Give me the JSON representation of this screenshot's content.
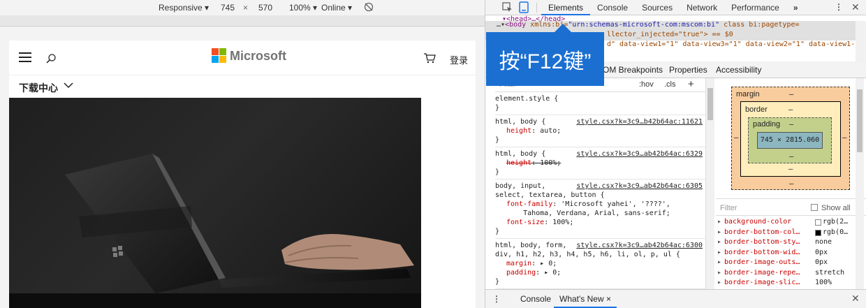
{
  "devbar": {
    "mode": "Responsive",
    "width": "745",
    "times": "×",
    "height": "570",
    "zoom": "100%",
    "network": "Online"
  },
  "site": {
    "brand": "Microsoft",
    "cart_label": "登录",
    "download_center": "下载中心"
  },
  "devtools": {
    "tabs": [
      "Elements",
      "Console",
      "Sources",
      "Network",
      "Performance"
    ],
    "more": "»",
    "dom": {
      "line0": "▾<head>…</head>",
      "line1_prefix": "…▾",
      "line1_tag": "<body",
      "line1_attr": " xmlns:bi=",
      "line1_val": "\"urn:schemas-microsoft-com:mscom:bi\"",
      "line1_rest": " class bi:pagetype=",
      "line2": "llector_injected=\"true\"> == $0",
      "line3": "d\" data-view1=\"1\" data-view3=\"1\" data-view2=\"1\" data-view1-"
    },
    "subtabs": [
      "OM Breakpoints",
      "Properties",
      "Accessibility"
    ],
    "filter_placeholder": "Filter",
    "hov": ":hov",
    "cls": ".cls",
    "plus": "+",
    "styles": [
      {
        "sel": "element.style {",
        "lines": [],
        "close": "}",
        "src": ""
      },
      {
        "sel": "html, body {",
        "lines": [
          {
            "p": "height",
            "v": "auto;"
          }
        ],
        "close": "}",
        "src": "style.csx?k=3c9…b42b64ac:11621",
        "strike": false
      },
      {
        "sel": "html, body {",
        "lines": [
          {
            "p": "height",
            "v": "100%;"
          }
        ],
        "close": "}",
        "src": "style.csx?k=3c9…ab42b64ac:6329",
        "strike": true
      },
      {
        "sel": "body, input,\nselect, textarea, button {",
        "lines": [
          {
            "p": "font-family",
            "v": "'Microsoft yahei', '????',\n    Tahoma, Verdana, Arial, sans-serif;"
          },
          {
            "p": "font-size",
            "v": "100%;"
          }
        ],
        "close": "}",
        "src": "style.csx?k=3c9…ab42b64ac:6305",
        "strike": false
      },
      {
        "sel": "html, body, form,\ndiv, h1, h2, h3, h4, h5, h6, li, ol, p, ul {",
        "lines": [
          {
            "p": "margin",
            "v": "▸ 0;"
          },
          {
            "p": "padding",
            "v": "▸ 0;"
          }
        ],
        "close": "}",
        "src": "style.csx?k=3c9…ab42b64ac:6300",
        "strike": false
      }
    ],
    "boxmodel": {
      "margin": "margin",
      "border": "border",
      "padding": "padding",
      "dash": "–",
      "content": "745 × 2815.060"
    },
    "computed_filter": "Filter",
    "show_all": "Show all",
    "computed": [
      {
        "p": "background-color",
        "v": "rgb(2…",
        "sw": "#ffffff"
      },
      {
        "p": "border-bottom-col…",
        "v": "rgb(0…",
        "sw": "#000000"
      },
      {
        "p": "border-bottom-sty…",
        "v": "none",
        "sw": ""
      },
      {
        "p": "border-bottom-wid…",
        "v": "0px",
        "sw": ""
      },
      {
        "p": "border-image-outs…",
        "v": "0px",
        "sw": ""
      },
      {
        "p": "border-image-repe…",
        "v": "stretch",
        "sw": ""
      },
      {
        "p": "border-image-slic…",
        "v": "100%",
        "sw": ""
      }
    ],
    "drawer_tabs": [
      "Console",
      "What's New"
    ],
    "drawer_close": "×"
  },
  "callout": "按“F12键”",
  "colors": {
    "accent": "#1a73e8",
    "callout": "#1b6fd1",
    "margin_box": "#f9cc9d",
    "border_box": "#ffeebc",
    "padding_box": "#c3d08b",
    "content_box": "#8cb6c0"
  }
}
